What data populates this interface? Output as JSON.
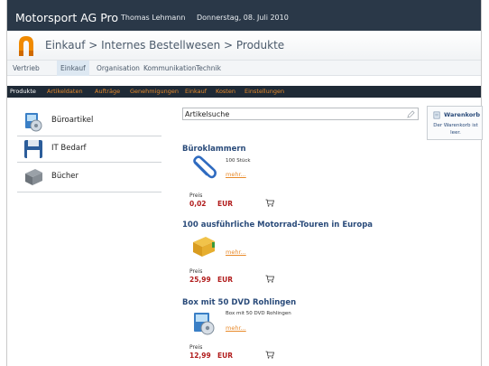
{
  "topbar": {
    "app_title": "Motorsport AG Pro",
    "user_name": "Thomas Lehmann",
    "date": "Donnerstag, 08. Juli 2010"
  },
  "header": {
    "breadcrumb": "Einkauf > Internes Bestellwesen > Produkte",
    "logo_color": "#f08a00"
  },
  "nav": {
    "tabs": [
      {
        "label": "Vertrieb"
      },
      {
        "label": "Einkauf",
        "active": true
      },
      {
        "label": "Organisation"
      },
      {
        "label": "Kommunikation"
      },
      {
        "label": "Technik"
      }
    ]
  },
  "subnav": {
    "items": [
      {
        "label": "Produkte",
        "active": true
      },
      {
        "label": "Artikeldaten"
      },
      {
        "label": "Aufträge"
      },
      {
        "label": "Genehmigungen"
      },
      {
        "label": "Einkauf"
      },
      {
        "label": "Kosten"
      },
      {
        "label": "Einstellungen"
      }
    ],
    "accent": "#e88a2a"
  },
  "categories": [
    {
      "label": "Büroartikel",
      "icon": "office-supplies-icon"
    },
    {
      "label": "IT Bedarf",
      "icon": "floppy-disk-icon"
    },
    {
      "label": "Bücher",
      "icon": "book-icon"
    }
  ],
  "search": {
    "value": "Artikelsuche"
  },
  "cart": {
    "title": "Warenkorb",
    "text": "Der Warenkorb ist leer."
  },
  "products": [
    {
      "title": "Büroklammern",
      "description": "100 Stück",
      "more": "mehr...",
      "price_label": "Preis",
      "price": "0,02",
      "currency": "EUR",
      "icon": "paperclip-icon"
    },
    {
      "title": "100 ausführliche Motorrad-Touren in Europa",
      "description": "",
      "more": "mehr...",
      "price_label": "Preis",
      "price": "25,99",
      "currency": "EUR",
      "icon": "book-icon"
    },
    {
      "title": "Box mit 50 DVD Rohlingen",
      "description": "Box mit 50 DVD Rohlingen",
      "more": "mehr...",
      "price_label": "Preis",
      "price": "12,99",
      "currency": "EUR",
      "icon": "dvd-box-icon"
    }
  ]
}
